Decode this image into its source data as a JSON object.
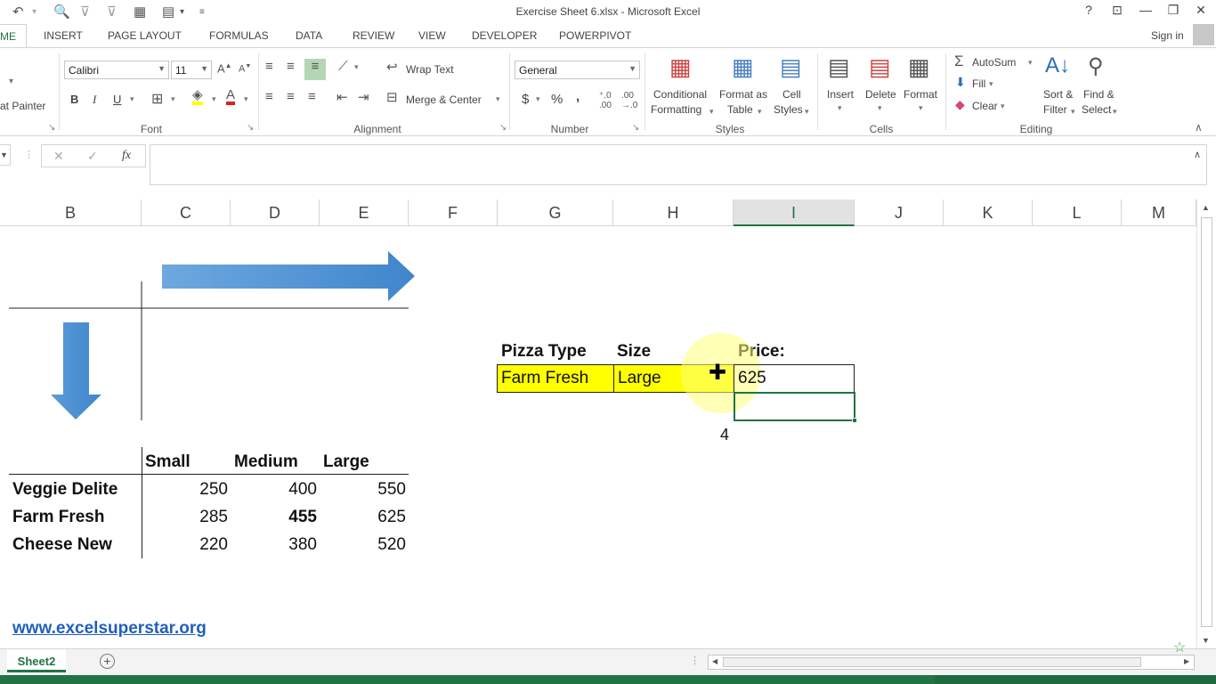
{
  "window": {
    "title": "Exercise Sheet 6.xlsx - Microsoft Excel",
    "help": "?",
    "sign_in": "Sign in"
  },
  "tabs": [
    {
      "label": "ME",
      "selected": true
    },
    {
      "label": "INSERT"
    },
    {
      "label": "PAGE LAYOUT"
    },
    {
      "label": "FORMULAS"
    },
    {
      "label": "DATA"
    },
    {
      "label": "REVIEW"
    },
    {
      "label": "VIEW"
    },
    {
      "label": "DEVELOPER"
    },
    {
      "label": "POWERPIVOT"
    }
  ],
  "ribbon": {
    "clipboard": {
      "format_painter": "at Painter"
    },
    "font": {
      "group_label": "Font",
      "font_name": "Calibri",
      "font_size": "11",
      "bold": "B",
      "italic": "I",
      "underline": "U"
    },
    "alignment": {
      "group_label": "Alignment",
      "wrap_text": "Wrap Text",
      "merge_center": "Merge & Center"
    },
    "number": {
      "group_label": "Number",
      "format": "General",
      "currency": "$",
      "percent": "%",
      "comma": ","
    },
    "styles": {
      "group_label": "Styles",
      "conditional_1": "Conditional",
      "conditional_2": "Formatting",
      "format_as_1": "Format as",
      "format_as_2": "Table",
      "cell_styles_1": "Cell",
      "cell_styles_2": "Styles"
    },
    "cells": {
      "group_label": "Cells",
      "insert": "Insert",
      "delete": "Delete",
      "format": "Format"
    },
    "editing": {
      "group_label": "Editing",
      "autosum": "AutoSum",
      "fill": "Fill",
      "clear": "Clear",
      "sort_1": "Sort &",
      "sort_2": "Filter",
      "find_1": "Find &",
      "find_2": "Select"
    }
  },
  "formula_bar": {
    "cancel": "✕",
    "enter": "✓",
    "fx": "fx",
    "value": ""
  },
  "columns": [
    "B",
    "C",
    "D",
    "E",
    "F",
    "G",
    "H",
    "I",
    "J",
    "K",
    "L",
    "M"
  ],
  "selected_column": "I",
  "lookup": {
    "header_type": "Pizza Type",
    "header_size": "Size",
    "header_price": "Price:",
    "value_type": "Farm Fresh",
    "value_size": "Large",
    "value_price": "625",
    "floating_number": "4"
  },
  "table": {
    "headers": [
      "Small",
      "Medium",
      "Large"
    ],
    "rows": [
      {
        "name": "Veggie Delite",
        "values": [
          "250",
          "400",
          "550"
        ]
      },
      {
        "name": "Farm Fresh",
        "values": [
          "285",
          "455",
          "625"
        ]
      },
      {
        "name": "Cheese New",
        "values": [
          "220",
          "380",
          "520"
        ]
      }
    ]
  },
  "link": "www.excelsuperstar.org",
  "sheet_tab": "Sheet2",
  "colors": {
    "excel_green": "#217346",
    "highlight_yellow": "#ffff00",
    "arrow_blue": "#4a8fd0",
    "link_blue": "#1f5fbf"
  }
}
